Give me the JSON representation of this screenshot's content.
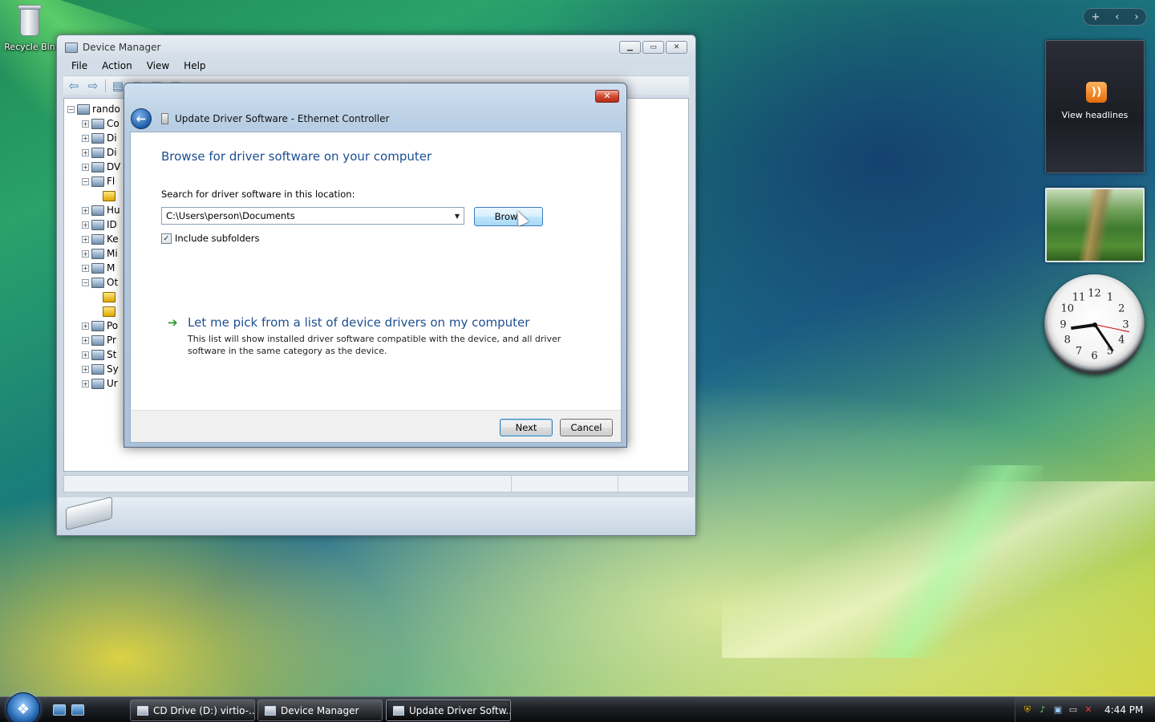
{
  "desktop": {
    "recycle_bin_label": "Recycle Bin"
  },
  "sidebar": {
    "topbar_buttons": [
      "+",
      "‹",
      "›"
    ],
    "rss_text": "View headlines",
    "clock_numbers": [
      "12",
      "1",
      "2",
      "3",
      "4",
      "5",
      "6",
      "7",
      "8",
      "9",
      "10",
      "11"
    ]
  },
  "device_manager": {
    "title": "Device Manager",
    "menu": [
      "File",
      "Action",
      "View",
      "Help"
    ],
    "tree": [
      {
        "label": "rando",
        "expander": "−"
      },
      {
        "label": "Co",
        "expander": "+"
      },
      {
        "label": "Di",
        "expander": "+"
      },
      {
        "label": "Di",
        "expander": "+"
      },
      {
        "label": "DV",
        "expander": "+"
      },
      {
        "label": "Fl",
        "expander": "−"
      },
      {
        "label": "",
        "expander": ""
      },
      {
        "label": "Hu",
        "expander": "+"
      },
      {
        "label": "ID",
        "expander": "+"
      },
      {
        "label": "Ke",
        "expander": "+"
      },
      {
        "label": "Mi",
        "expander": "+"
      },
      {
        "label": "M",
        "expander": "+"
      },
      {
        "label": "Ot",
        "expander": "−"
      },
      {
        "label": "",
        "expander": ""
      },
      {
        "label": "",
        "expander": ""
      },
      {
        "label": "Po",
        "expander": "+"
      },
      {
        "label": "Pr",
        "expander": "+"
      },
      {
        "label": "St",
        "expander": "+"
      },
      {
        "label": "Sy",
        "expander": "+"
      },
      {
        "label": "Ur",
        "expander": "+"
      }
    ]
  },
  "update_driver": {
    "title": "Update Driver Software - Ethernet Controller",
    "close_label": "✕",
    "heading": "Browse for driver software on your computer",
    "search_label": "Search for driver software in this location:",
    "path_value": "C:\\Users\\person\\Documents",
    "browse_label": "Brows",
    "include_subfolders_label": "Include subfolders",
    "include_subfolders_checked": true,
    "pick_title": "Let me pick from a list of device drivers on my computer",
    "pick_desc": "This list will show installed driver software compatible with the device, and all driver software in the same category as the device.",
    "next_label": "Next",
    "cancel_label": "Cancel"
  },
  "taskbar": {
    "buttons": [
      {
        "label": "CD Drive (D:) virtio-...",
        "active": false
      },
      {
        "label": "Device Manager",
        "active": false
      },
      {
        "label": "Update Driver Softw...",
        "active": true
      }
    ],
    "time": "4:44 PM"
  }
}
